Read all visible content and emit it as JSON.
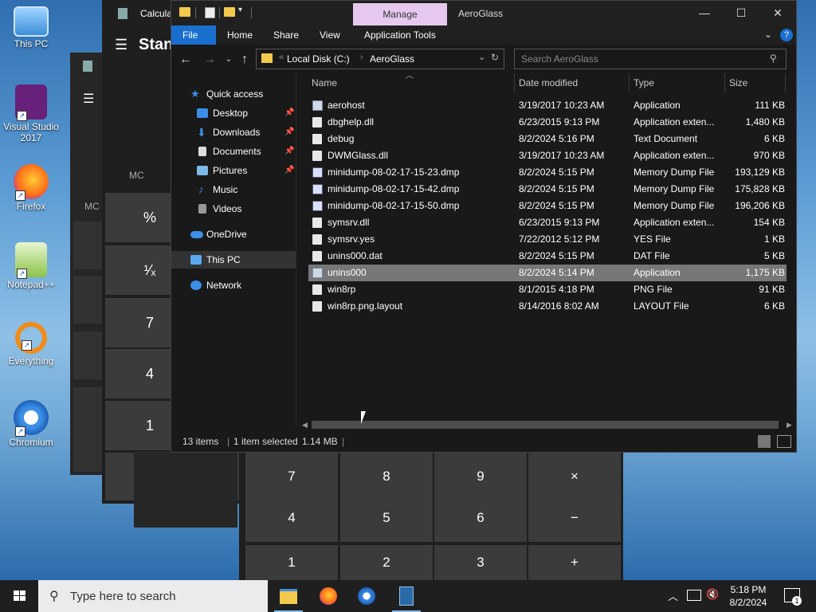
{
  "desktop": {
    "icons": [
      {
        "label": "This PC"
      },
      {
        "label": "Visual Studio 2017"
      },
      {
        "label": "Firefox"
      },
      {
        "label": "Notepad++"
      },
      {
        "label": "Everything"
      },
      {
        "label": "Chromium"
      }
    ]
  },
  "calculator_back": {
    "title": "Calcula",
    "mode": "Stan",
    "memory_labels": [
      "MC",
      "MC"
    ],
    "buttons": [
      "%",
      "¹⁄ₓ",
      "7",
      "4",
      "1",
      "+/_"
    ]
  },
  "calculator_front": {
    "keys": [
      "7",
      "8",
      "9",
      "×",
      "4",
      "5",
      "6",
      "−",
      "1",
      "2",
      "3",
      "+"
    ]
  },
  "explorer": {
    "manage_tab": "Manage",
    "window_title": "AeroGlass",
    "ribbon_tabs": [
      "File",
      "Home",
      "Share",
      "View",
      "Application Tools"
    ],
    "address": {
      "drive": "Local Disk (C:)",
      "folder": "AeroGlass"
    },
    "search_placeholder": "Search AeroGlass",
    "nav": {
      "quick_access": "Quick access",
      "items": [
        "Desktop",
        "Downloads",
        "Documents",
        "Pictures",
        "Music",
        "Videos"
      ],
      "onedrive": "OneDrive",
      "this_pc": "This PC",
      "network": "Network"
    },
    "columns": {
      "name": "Name",
      "date": "Date modified",
      "type": "Type",
      "size": "Size"
    },
    "files": [
      {
        "name": "aerohost",
        "date": "3/19/2017 10:23 AM",
        "type": "Application",
        "size": "111 KB",
        "icon": "app"
      },
      {
        "name": "dbghelp.dll",
        "date": "6/23/2015 9:13 PM",
        "type": "Application exten...",
        "size": "1,480 KB",
        "icon": "dll"
      },
      {
        "name": "debug",
        "date": "8/2/2024 5:16 PM",
        "type": "Text Document",
        "size": "6 KB",
        "icon": "txt"
      },
      {
        "name": "DWMGlass.dll",
        "date": "3/19/2017 10:23 AM",
        "type": "Application exten...",
        "size": "970 KB",
        "icon": "dll"
      },
      {
        "name": "minidump-08-02-17-15-23.dmp",
        "date": "8/2/2024 5:15 PM",
        "type": "Memory Dump File",
        "size": "193,129 KB",
        "icon": "dmp"
      },
      {
        "name": "minidump-08-02-17-15-42.dmp",
        "date": "8/2/2024 5:15 PM",
        "type": "Memory Dump File",
        "size": "175,828 KB",
        "icon": "dmp"
      },
      {
        "name": "minidump-08-02-17-15-50.dmp",
        "date": "8/2/2024 5:15 PM",
        "type": "Memory Dump File",
        "size": "196,206 KB",
        "icon": "dmp"
      },
      {
        "name": "symsrv.dll",
        "date": "6/23/2015 9:13 PM",
        "type": "Application exten...",
        "size": "154 KB",
        "icon": "dll"
      },
      {
        "name": "symsrv.yes",
        "date": "7/22/2012 5:12 PM",
        "type": "YES File",
        "size": "1 KB",
        "icon": "txt"
      },
      {
        "name": "unins000.dat",
        "date": "8/2/2024 5:15 PM",
        "type": "DAT File",
        "size": "5 KB",
        "icon": "txt"
      },
      {
        "name": "unins000",
        "date": "8/2/2024 5:14 PM",
        "type": "Application",
        "size": "1,175 KB",
        "icon": "app",
        "selected": true
      },
      {
        "name": "win8rp",
        "date": "8/1/2015 4:18 PM",
        "type": "PNG File",
        "size": "91 KB",
        "icon": "txt"
      },
      {
        "name": "win8rp.png.layout",
        "date": "8/14/2016 8:02 AM",
        "type": "LAYOUT File",
        "size": "6 KB",
        "icon": "txt"
      }
    ],
    "status": {
      "count": "13 items",
      "selected": "1 item selected",
      "size": "1.14 MB"
    }
  },
  "taskbar": {
    "search_placeholder": "Type here to search",
    "time": "5:18 PM",
    "date": "8/2/2024",
    "notification_count": "1"
  },
  "colors": {
    "accent": "#1a6fce",
    "manage_tab": "#e6c8ef",
    "dark_bg": "#191919"
  }
}
